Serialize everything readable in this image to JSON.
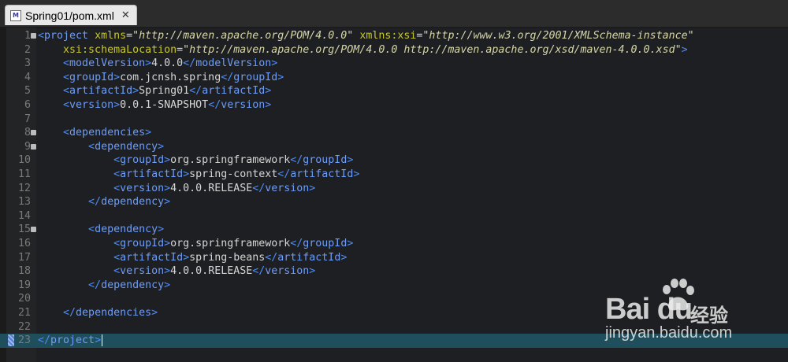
{
  "tab": {
    "title": "Spring01/pom.xml",
    "icon": "xml-file-icon",
    "close": "✕"
  },
  "lines": [
    {
      "n": "1",
      "fold": true,
      "html": "<span class=\"tg\">&lt;</span><span class=\"tn\">project</span> <span class=\"at\">xmlns</span><span class=\"tx\">=</span><span class=\"av\">\"http://maven.apache.org/POM/4.0.0\"</span> <span class=\"at\">xmlns:xsi</span><span class=\"tx\">=</span><span class=\"av\">\"http://www.w3.org/2001/XMLSchema-instance\"</span>"
    },
    {
      "n": "2",
      "html": "    <span class=\"at\">xsi:schemaLocation</span><span class=\"tx\">=</span><span class=\"av\">\"http://maven.apache.org/POM/4.0.0 http://maven.apache.org/xsd/maven-4.0.0.xsd\"</span><span class=\"tg\">&gt;</span>"
    },
    {
      "n": "3",
      "html": "    <span class=\"tg\">&lt;</span><span class=\"tn\">modelVersion</span><span class=\"tg\">&gt;</span><span class=\"tx\">4.0.0</span><span class=\"tg\">&lt;/</span><span class=\"tn\">modelVersion</span><span class=\"tg\">&gt;</span>"
    },
    {
      "n": "4",
      "html": "    <span class=\"tg\">&lt;</span><span class=\"tn\">groupId</span><span class=\"tg\">&gt;</span><span class=\"tx\">com.jcnsh.spring</span><span class=\"tg\">&lt;/</span><span class=\"tn\">groupId</span><span class=\"tg\">&gt;</span>"
    },
    {
      "n": "5",
      "html": "    <span class=\"tg\">&lt;</span><span class=\"tn\">artifactId</span><span class=\"tg\">&gt;</span><span class=\"tx\">Spring01</span><span class=\"tg\">&lt;/</span><span class=\"tn\">artifactId</span><span class=\"tg\">&gt;</span>"
    },
    {
      "n": "6",
      "html": "    <span class=\"tg\">&lt;</span><span class=\"tn\">version</span><span class=\"tg\">&gt;</span><span class=\"tx\">0.0.1-SNAPSHOT</span><span class=\"tg\">&lt;/</span><span class=\"tn\">version</span><span class=\"tg\">&gt;</span>"
    },
    {
      "n": "7",
      "html": ""
    },
    {
      "n": "8",
      "fold": true,
      "html": "    <span class=\"tg\">&lt;</span><span class=\"tn\">dependencies</span><span class=\"tg\">&gt;</span>"
    },
    {
      "n": "9",
      "fold": true,
      "html": "        <span class=\"tg\">&lt;</span><span class=\"tn\">dependency</span><span class=\"tg\">&gt;</span>"
    },
    {
      "n": "10",
      "html": "            <span class=\"tg\">&lt;</span><span class=\"tn\">groupId</span><span class=\"tg\">&gt;</span><span class=\"tx\">org.springframework</span><span class=\"tg\">&lt;/</span><span class=\"tn\">groupId</span><span class=\"tg\">&gt;</span>"
    },
    {
      "n": "11",
      "html": "            <span class=\"tg\">&lt;</span><span class=\"tn\">artifactId</span><span class=\"tg\">&gt;</span><span class=\"tx\">spring-context</span><span class=\"tg\">&lt;/</span><span class=\"tn\">artifactId</span><span class=\"tg\">&gt;</span>"
    },
    {
      "n": "12",
      "html": "            <span class=\"tg\">&lt;</span><span class=\"tn\">version</span><span class=\"tg\">&gt;</span><span class=\"tx\">4.0.0.RELEASE</span><span class=\"tg\">&lt;/</span><span class=\"tn\">version</span><span class=\"tg\">&gt;</span>"
    },
    {
      "n": "13",
      "html": "        <span class=\"tg\">&lt;/</span><span class=\"tn\">dependency</span><span class=\"tg\">&gt;</span>"
    },
    {
      "n": "14",
      "html": ""
    },
    {
      "n": "15",
      "fold": true,
      "html": "        <span class=\"tg\">&lt;</span><span class=\"tn\">dependency</span><span class=\"tg\">&gt;</span>"
    },
    {
      "n": "16",
      "html": "            <span class=\"tg\">&lt;</span><span class=\"tn\">groupId</span><span class=\"tg\">&gt;</span><span class=\"tx\">org.springframework</span><span class=\"tg\">&lt;/</span><span class=\"tn\">groupId</span><span class=\"tg\">&gt;</span>"
    },
    {
      "n": "17",
      "html": "            <span class=\"tg\">&lt;</span><span class=\"tn\">artifactId</span><span class=\"tg\">&gt;</span><span class=\"tx\">spring-beans</span><span class=\"tg\">&lt;/</span><span class=\"tn\">artifactId</span><span class=\"tg\">&gt;</span>"
    },
    {
      "n": "18",
      "html": "            <span class=\"tg\">&lt;</span><span class=\"tn\">version</span><span class=\"tg\">&gt;</span><span class=\"tx\">4.0.0.RELEASE</span><span class=\"tg\">&lt;/</span><span class=\"tn\">version</span><span class=\"tg\">&gt;</span>"
    },
    {
      "n": "19",
      "html": "        <span class=\"tg\">&lt;/</span><span class=\"tn\">dependency</span><span class=\"tg\">&gt;</span>"
    },
    {
      "n": "20",
      "html": ""
    },
    {
      "n": "21",
      "html": "    <span class=\"tg\">&lt;/</span><span class=\"tn\">dependencies</span><span class=\"tg\">&gt;</span>"
    },
    {
      "n": "22",
      "html": ""
    },
    {
      "n": "23",
      "current": true,
      "bookmark": true,
      "html": "<span class=\"tg\">&lt;/</span><span class=\"tn\">project</span><span class=\"tg\">&gt;</span><span class=\"caret\"></span>"
    }
  ],
  "watermark": {
    "brand": "Bai du",
    "cn": "经验",
    "url": "jingyan.baidu.com",
    "icon": "paw-icon"
  }
}
